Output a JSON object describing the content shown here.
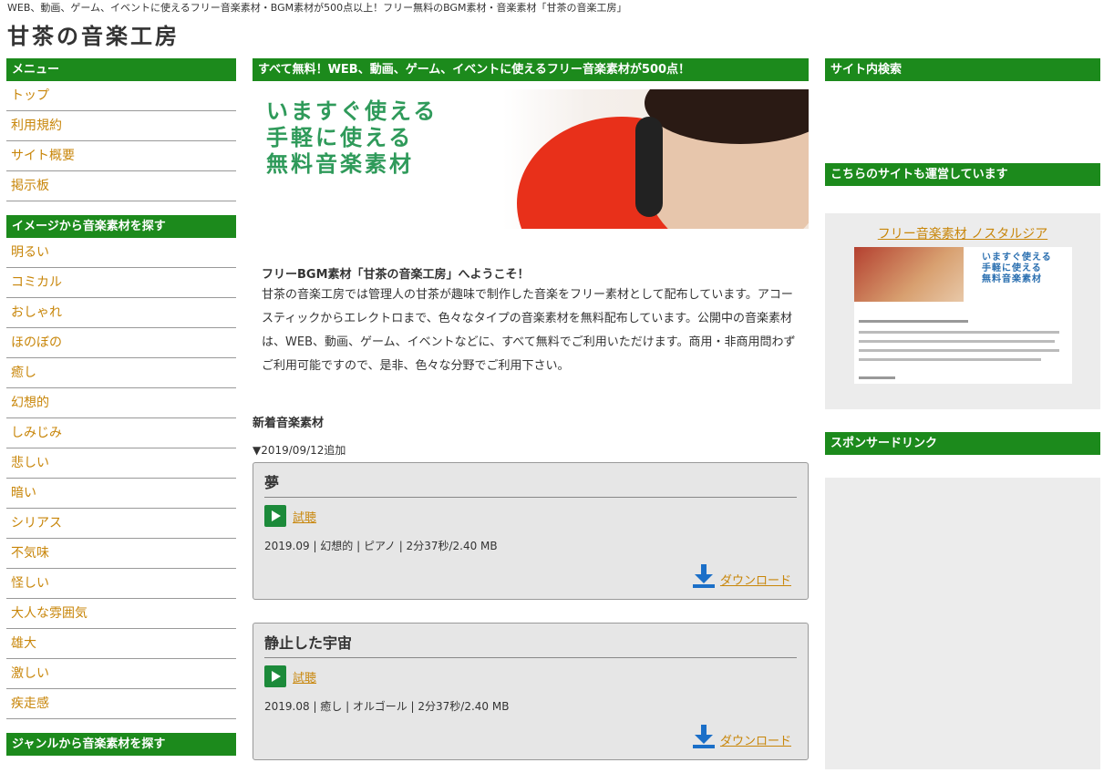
{
  "header": {
    "tagline": "WEB、動画、ゲーム、イベントに使えるフリー音楽素材・BGM素材が500点以上！フリー無料のBGM素材・音楽素材「甘茶の音楽工房」",
    "logo": "甘茶の音楽工房"
  },
  "sidebar": {
    "menu_title": "メニュー",
    "menu_items": [
      "トップ",
      "利用規約",
      "サイト概要",
      "掲示板"
    ],
    "image_title": "イメージから音楽素材を探す",
    "image_items": [
      "明るい",
      "コミカル",
      "おしゃれ",
      "ほのぼの",
      "癒し",
      "幻想的",
      "しみじみ",
      "悲しい",
      "暗い",
      "シリアス",
      "不気味",
      "怪しい",
      "大人な雰囲気",
      "雄大",
      "激しい",
      "疾走感"
    ],
    "genre_title": "ジャンルから音楽素材を探す"
  },
  "main": {
    "banner_title": "すべて無料！WEB、動画、ゲーム、イベントに使えるフリー音楽素材が500点！",
    "hero_lines": [
      "いますぐ使える",
      "手軽に使える",
      "無料音楽素材"
    ],
    "welcome_title": "フリーBGM素材「甘茶の音楽工房」へようこそ！",
    "welcome_body": "甘茶の音楽工房では管理人の甘茶が趣味で制作した音楽をフリー素材として配布しています。アコースティックからエレクトロまで、色々なタイプの音楽素材を無料配布しています。公開中の音楽素材は、WEB、動画、ゲーム、イベントなどに、すべて無料でご利用いただけます。商用・非商用問わずご利用可能ですので、是非、色々な分野でご利用下さい。",
    "new_title": "新着音楽素材",
    "date_line": "▼2019/09/12追加",
    "tracks": [
      {
        "title": "夢",
        "listen": "試聴",
        "meta": "2019.09 | 幻想的 | ピアノ | 2分37秒/2.40 MB",
        "download": "ダウンロード"
      },
      {
        "title": "静止した宇宙",
        "listen": "試聴",
        "meta": "2019.08 | 癒し | オルゴール | 2分37秒/2.40 MB",
        "download": "ダウンロード"
      }
    ]
  },
  "right": {
    "search_title": "サイト内検索",
    "partner_title": "こちらのサイトも運営しています",
    "partner_link": "フリー音楽素材 ノスタルジア",
    "partner_thumb_lines": [
      "いますぐ使える",
      "手軽に使える",
      "無料音楽素材"
    ],
    "sponsor_title": "スポンサードリンク"
  },
  "colors": {
    "accent_green": "#1c8a1c",
    "link_orange": "#c8860a",
    "download_blue": "#1b6fc8"
  }
}
